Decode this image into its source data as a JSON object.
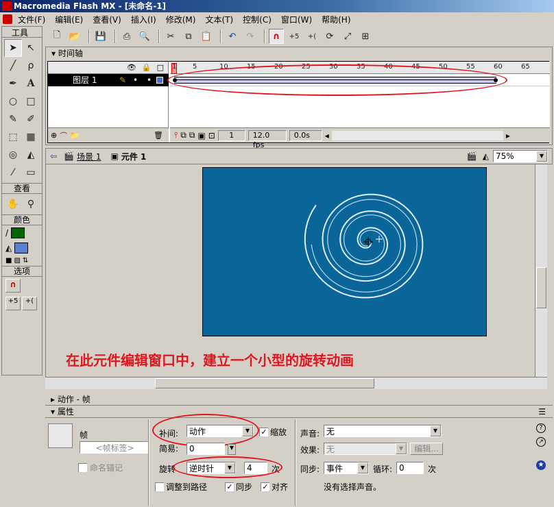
{
  "window": {
    "title": "Macromedia Flash MX - [未命名-1]"
  },
  "menu": {
    "items": [
      "文件(F)",
      "编辑(E)",
      "查看(V)",
      "插入(I)",
      "修改(M)",
      "文本(T)",
      "控制(C)",
      "窗口(W)",
      "帮助(H)"
    ]
  },
  "tools": {
    "title": "工具",
    "view_label": "查看",
    "colors_label": "颜色",
    "options_label": "选项",
    "stroke_color": "#006600",
    "fill_color": "#5a7ed0"
  },
  "timeline": {
    "title": "时间轴",
    "ruler": [
      "1",
      "5",
      "10",
      "15",
      "20",
      "25",
      "30",
      "35",
      "40",
      "45",
      "50",
      "55",
      "60",
      "65"
    ],
    "layer_name": "图层 1",
    "current_frame": "1",
    "fps": "12.0 fps",
    "elapsed": "0.0s"
  },
  "stage": {
    "scene_label": "场景 1",
    "symbol_label": "元件 1",
    "zoom": "75%",
    "canvas_color": "#0a6699"
  },
  "annotation": {
    "text": "在此元件编辑窗口中，建立一个小型的旋转动画"
  },
  "panels": {
    "actions_title": "动作 - 帧",
    "properties_title": "属性"
  },
  "props": {
    "frame_label": "帧",
    "frame_name_placeholder": "<帧标签>",
    "named_anchor": "命名锚记",
    "tween_label": "补间:",
    "tween_value": "动作",
    "scale_label": "缩放",
    "ease_label": "简易:",
    "ease_value": "0",
    "rotate_label": "旋转",
    "rotate_value": "逆时针",
    "rotate_times": "4",
    "times_unit": "次",
    "orient_path": "调整到路径",
    "sync_label": "同步",
    "snap_label": "对齐",
    "sound_label": "声音:",
    "sound_value": "无",
    "effect_label": "效果:",
    "effect_value": "无",
    "edit_button": "编辑...",
    "sync2_label": "同步:",
    "sync2_value": "事件",
    "loop_label": "循环:",
    "loop_value": "0",
    "loop_unit": "次",
    "no_sound": "没有选择声音。"
  }
}
